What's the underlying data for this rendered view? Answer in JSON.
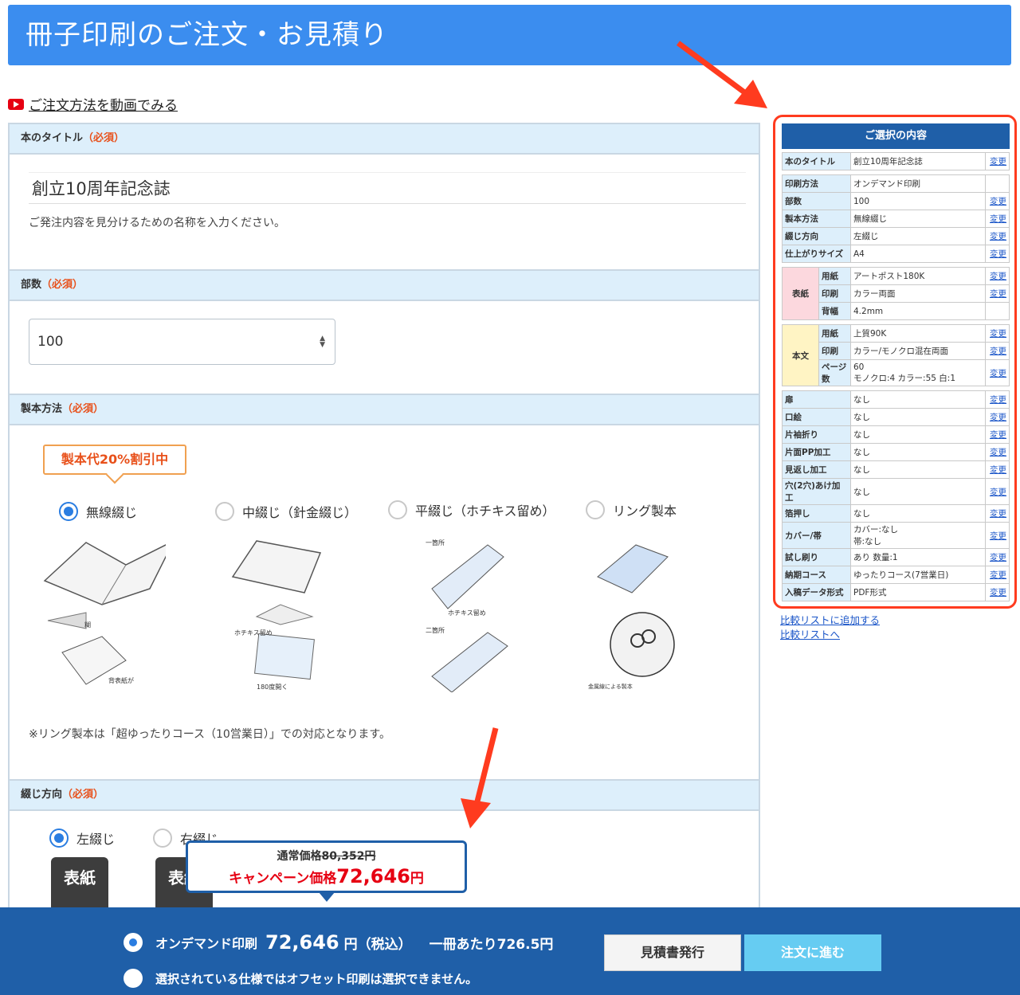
{
  "header": {
    "title": "冊子印刷のご注文・お見積り"
  },
  "video_link": "ご注文方法を動画でみる",
  "sections": {
    "title": {
      "label": "本のタイトル",
      "req": "（必須）",
      "value": "創立10周年記念誌",
      "help": "ご発注内容を見分けるための名称を入力ください。"
    },
    "qty": {
      "label": "部数",
      "req": "（必須）",
      "value": "100"
    },
    "binding": {
      "label": "製本方法",
      "req": "（必須）",
      "discount": "製本代20%割引中",
      "options": [
        {
          "label": "無線綴じ",
          "selected": true,
          "captions": [
            "糊",
            "背表紙が\nあります。"
          ]
        },
        {
          "label": "中綴じ（針金綴じ）",
          "selected": false,
          "captions": [
            "ホチキス留め",
            "180度開く"
          ]
        },
        {
          "label": "平綴じ（ホチキス留め）",
          "selected": false,
          "captions": [
            "一箇所",
            "ホチキス留め",
            "二箇所"
          ]
        },
        {
          "label": "リング製本",
          "selected": false,
          "captions": [
            "金属線による製本"
          ]
        }
      ],
      "note": "※リング製本は「超ゆったりコース（10営業日）」での対応となります。"
    },
    "direction": {
      "label": "綴じ方向",
      "req": "（必須）",
      "options": [
        {
          "label": "左綴じ",
          "selected": true
        },
        {
          "label": "右綴じ",
          "selected": false
        }
      ],
      "book_label": "表紙"
    }
  },
  "price_popup": {
    "normal_prefix": "通常価格",
    "normal_price": "80,352円",
    "camp_prefix": "キャンペーン価格",
    "camp_price": "72,646",
    "camp_unit": "円"
  },
  "bottom": {
    "row1": {
      "method": "オンデマンド印刷",
      "price": "72,646",
      "unit": "円（税込）",
      "per": "一冊あたり726.5円"
    },
    "row2": "選択されている仕様ではオフセット印刷は選択できません。",
    "quote_btn": "見積書発行",
    "order_btn": "注文に進む"
  },
  "summary": {
    "title": "ご選択の内容",
    "change": "変更",
    "rows_top": [
      {
        "k": "本のタイトル",
        "v": "創立10周年記念誌",
        "c": true
      }
    ],
    "rows_basic": [
      {
        "k": "印刷方法",
        "v": "オンデマンド印刷",
        "c": false
      },
      {
        "k": "部数",
        "v": "100",
        "c": true
      },
      {
        "k": "製本方法",
        "v": "無線綴じ",
        "c": true
      },
      {
        "k": "綴じ方向",
        "v": "左綴じ",
        "c": true
      },
      {
        "k": "仕上がりサイズ",
        "v": "A4",
        "c": true
      }
    ],
    "cover": {
      "group": "表紙",
      "rows": [
        {
          "k": "用紙",
          "v": "アートポスト180K",
          "c": true
        },
        {
          "k": "印刷",
          "v": "カラー両面",
          "c": true
        },
        {
          "k": "背幅",
          "v": "4.2mm",
          "c": false
        }
      ]
    },
    "body": {
      "group": "本文",
      "rows": [
        {
          "k": "用紙",
          "v": "上質90K",
          "c": true
        },
        {
          "k": "印刷",
          "v": "カラー/モノクロ混在両面",
          "c": true
        },
        {
          "k": "ページ数",
          "v": "60\nモノクロ:4 カラー:55 白:1",
          "c": true
        }
      ]
    },
    "rows_opts": [
      {
        "k": "扉",
        "v": "なし"
      },
      {
        "k": "口絵",
        "v": "なし"
      },
      {
        "k": "片袖折り",
        "v": "なし"
      },
      {
        "k": "片面PP加工",
        "v": "なし"
      },
      {
        "k": "見返し加工",
        "v": "なし"
      },
      {
        "k": "穴(2穴)あけ加工",
        "v": "なし"
      },
      {
        "k": "箔押し",
        "v": "なし"
      },
      {
        "k": "カバー/帯",
        "v": "カバー:なし\n帯:なし"
      },
      {
        "k": "試し刷り",
        "v": "あり 数量:1"
      },
      {
        "k": "納期コース",
        "v": "ゆったりコース(7営業日)"
      },
      {
        "k": "入稿データ形式",
        "v": "PDF形式"
      }
    ],
    "links": [
      "比較リストに追加する",
      "比較リストへ"
    ]
  },
  "colors": {
    "accent": "#3b8def",
    "navy": "#1f5fa8",
    "warning": "#e8501a",
    "arrow": "#ff3b1f"
  }
}
